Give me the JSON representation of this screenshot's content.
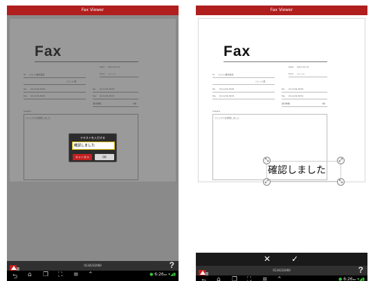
{
  "app": {
    "title": "Fax Viewer",
    "fax_number": "0134232060"
  },
  "fax_document": {
    "heading": "Fax",
    "date_label": "Date",
    "date_value": "2013.12.12",
    "from_label": "From",
    "from_value": "○○ ○○",
    "to_label": "To",
    "to_value": "○○○○株式会社",
    "to_person": "○○ ○○様",
    "tel_label": "Tel",
    "tel_value": "03-1234-5678",
    "fax_label": "Fax",
    "fax_value": "03-1234-5679",
    "pages_label": "送付枚数",
    "pages_value": "1枚",
    "subject_label": "Subject",
    "message": "ファックスを受領しました"
  },
  "dialog": {
    "title": "テキストを入力する",
    "input_value": "確認しました",
    "cancel_label": "キャンセル",
    "ok_label": "OK"
  },
  "annotation": {
    "text": "確認しました"
  },
  "confirm_bar": {
    "cancel_glyph": "✕",
    "accept_glyph": "✓"
  },
  "app_bar": {
    "help_label": "?"
  },
  "system_bar": {
    "time": "6:26",
    "ampm": "PM"
  },
  "icons": [
    "back-icon",
    "home-icon",
    "recent-apps-icon",
    "screenshot-icon",
    "menu-icon",
    "up-icon",
    "app-logo-icon",
    "help-icon",
    "resize-handle-icon"
  ],
  "colors": {
    "title_bar": "#b01e1e",
    "cancel_button": "#c42020",
    "dim_overlay": "#8a8a8a",
    "status_green": "#39c23b"
  }
}
